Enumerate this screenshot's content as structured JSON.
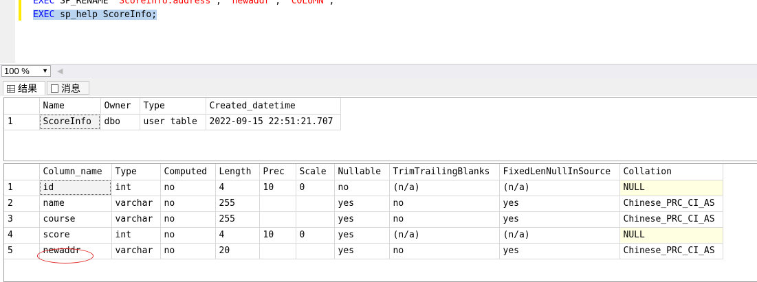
{
  "editor": {
    "line1": [
      {
        "t": "EXEC",
        "c": "kw"
      },
      {
        "t": " SP_RENAME ",
        "c": ""
      },
      {
        "t": "'ScoreInfo.address'",
        "c": "str"
      },
      {
        "t": ", ",
        "c": ""
      },
      {
        "t": "'newaddr'",
        "c": "str"
      },
      {
        "t": ", ",
        "c": ""
      },
      {
        "t": "'COLUMN'",
        "c": "str"
      },
      {
        "t": ";",
        "c": ""
      }
    ],
    "line2_kw": "EXEC",
    "line2_rest": " sp_help ScoreInfo;"
  },
  "zoom": {
    "value": "100 %"
  },
  "tabs": {
    "results": "结果",
    "messages": "消息"
  },
  "grid1": {
    "columns": [
      "Name",
      "Owner",
      "Type",
      "Created_datetime"
    ],
    "rows": [
      {
        "num": "1",
        "cells": [
          "ScoreInfo",
          "dbo",
          "user table",
          "2022-09-15 22:51:21.707"
        ]
      }
    ]
  },
  "grid2": {
    "columns": [
      "Column_name",
      "Type",
      "Computed",
      "Length",
      "Prec",
      "Scale",
      "Nullable",
      "TrimTrailingBlanks",
      "FixedLenNullInSource",
      "Collation"
    ],
    "rows": [
      {
        "num": "1",
        "cells": [
          "id",
          "int",
          "no",
          "4",
          "10",
          "0",
          "no",
          "(n/a)",
          "(n/a)",
          "NULL"
        ]
      },
      {
        "num": "2",
        "cells": [
          "name",
          "varchar",
          "no",
          "255",
          "",
          "",
          "yes",
          "no",
          "yes",
          "Chinese_PRC_CI_AS"
        ]
      },
      {
        "num": "3",
        "cells": [
          "course",
          "varchar",
          "no",
          "255",
          "",
          "",
          "yes",
          "no",
          "yes",
          "Chinese_PRC_CI_AS"
        ]
      },
      {
        "num": "4",
        "cells": [
          "score",
          "int",
          "no",
          "4",
          "10",
          "0",
          "yes",
          "(n/a)",
          "(n/a)",
          "NULL"
        ]
      },
      {
        "num": "5",
        "cells": [
          "newaddr",
          "varchar",
          "no",
          "20",
          "",
          "",
          "yes",
          "no",
          "yes",
          "Chinese_PRC_CI_AS"
        ]
      }
    ]
  }
}
